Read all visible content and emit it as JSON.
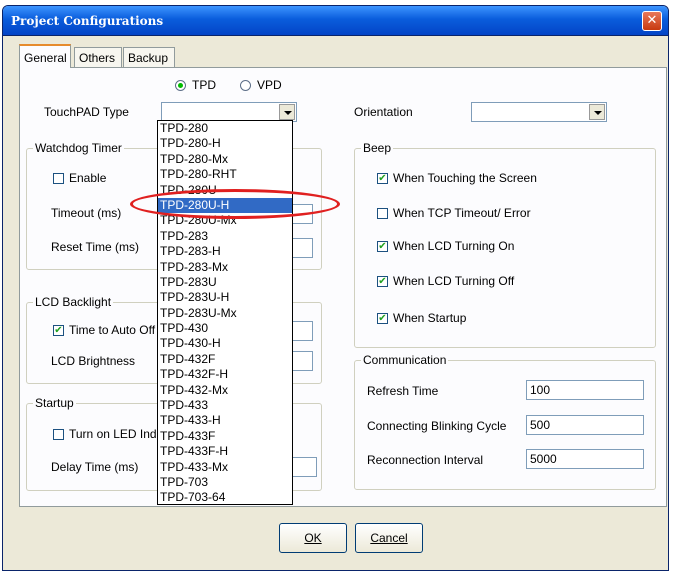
{
  "window": {
    "title": "Project Configurations",
    "close_glyph": "✕"
  },
  "tabs": [
    {
      "label": "General",
      "active": true
    },
    {
      "label": "Others",
      "active": false
    },
    {
      "label": "Backup",
      "active": false
    }
  ],
  "panel_type": {
    "radio_tpd": "TPD",
    "radio_vpd": "VPD",
    "selected": "TPD",
    "touchpad_label": "TouchPAD Type",
    "touchpad_value": "",
    "orientation_label": "Orientation",
    "orientation_value": ""
  },
  "dropdown": {
    "items": [
      "TPD-280",
      "TPD-280-H",
      "TPD-280-Mx",
      "TPD-280-RHT",
      "TPD-280U",
      "TPD-280U-H",
      "TPD-280U-Mx",
      "TPD-283",
      "TPD-283-H",
      "TPD-283-Mx",
      "TPD-283U",
      "TPD-283U-H",
      "TPD-283U-Mx",
      "TPD-430",
      "TPD-430-H",
      "TPD-432F",
      "TPD-432F-H",
      "TPD-432-Mx",
      "TPD-433",
      "TPD-433-H",
      "TPD-433F",
      "TPD-433F-H",
      "TPD-433-Mx",
      "TPD-703",
      "TPD-703-64"
    ],
    "selected": "TPD-280U-H"
  },
  "watchdog": {
    "title": "Watchdog Timer",
    "enable": "Enable",
    "enable_checked": false,
    "timeout": "Timeout (ms)",
    "reset": "Reset Time (ms)"
  },
  "backlight": {
    "title": "LCD Backlight",
    "auto_off": "Time to Auto Off",
    "auto_off_checked": true,
    "brightness": "LCD Brightness"
  },
  "startup": {
    "title": "Startup",
    "led": "Turn on LED Indi",
    "led_checked": false,
    "delay": "Delay Time (ms)"
  },
  "beep": {
    "title": "Beep",
    "items": [
      {
        "label": "When Touching the Screen",
        "checked": true
      },
      {
        "label": "When TCP Timeout/ Error",
        "checked": false
      },
      {
        "label": "When LCD Turning On",
        "checked": true
      },
      {
        "label": "When LCD Turning Off",
        "checked": true
      },
      {
        "label": "When Startup",
        "checked": true
      }
    ]
  },
  "communication": {
    "title": "Communication",
    "refresh_label": "Refresh Time",
    "refresh_value": "100",
    "blink_label": "Connecting Blinking Cycle",
    "blink_value": "500",
    "reconnect_label": "Reconnection Interval",
    "reconnect_value": "5000"
  },
  "buttons": {
    "ok": "OK",
    "cancel": "Cancel"
  },
  "colors": {
    "highlight": "#e02020",
    "selection": "#316ac5"
  }
}
